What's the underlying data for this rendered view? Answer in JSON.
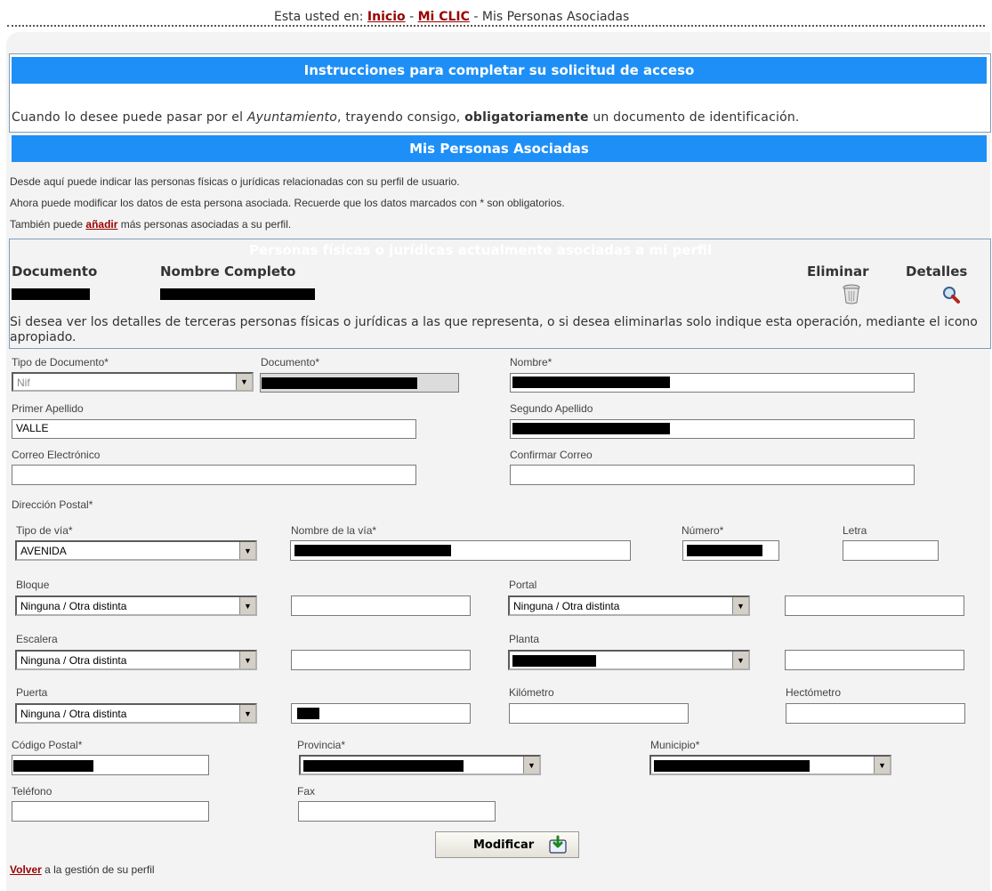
{
  "breadcrumb": {
    "prefix": "Esta usted en:",
    "items": [
      "Inicio",
      "Mi CLIC"
    ],
    "current": "Mis Personas Asociadas"
  },
  "instructions": {
    "title": "Instrucciones para completar su solicitud de acceso",
    "text_1": "Cuando lo desee puede pasar por el ",
    "text_em": "Ayuntamiento",
    "text_2": ", trayendo consigo, ",
    "text_strong": "obligatoriamente",
    "text_3": " un documento de identificación."
  },
  "section": {
    "title": "Mis Personas Asociadas",
    "line_1": "Desde aquí puede indicar las personas físicas o jurídicas relacionadas con su perfil de usuario.",
    "line_2": "Ahora puede modificar los datos de esta persona asociada. Recuerde que los datos marcados con * son obligatorios.",
    "line_3_prefix": "También puede ",
    "line_3_link": "añadir",
    "line_3_suffix": " más personas asociadas a su perfil."
  },
  "associated_table": {
    "title": "Personas físicas o jurídicas actualmente asociadas a mi perfil",
    "columns": [
      "Documento",
      "Nombre Completo",
      "Eliminar",
      "Detalles"
    ],
    "note": "Si desea ver los detalles de terceras personas físicas o jurídicas a las que representa, o si desea eliminarlas solo indique esta operación, mediante el icono apropiado."
  },
  "form": {
    "tipo_documento": {
      "label": "Tipo de Documento*",
      "value": "Nif"
    },
    "documento": {
      "label": "Documento*"
    },
    "nombre": {
      "label": "Nombre*"
    },
    "primer_apellido": {
      "label": "Primer Apellido",
      "value": "VALLE"
    },
    "segundo_apellido": {
      "label": "Segundo Apellido"
    },
    "correo": {
      "label": "Correo Electrónico",
      "value": ""
    },
    "confirmar_correo": {
      "label": "Confirmar Correo",
      "value": ""
    },
    "direccion_label": "Dirección Postal*",
    "tipo_via": {
      "label": "Tipo de vía*",
      "value": "AVENIDA"
    },
    "nombre_via": {
      "label": "Nombre de la vía*"
    },
    "numero": {
      "label": "Número*"
    },
    "letra": {
      "label": "Letra",
      "value": ""
    },
    "bloque": {
      "label": "Bloque",
      "value": "Ninguna / Otra distinta"
    },
    "portal": {
      "label": "Portal",
      "value": "Ninguna / Otra distinta"
    },
    "escalera": {
      "label": "Escalera",
      "value": "Ninguna / Otra distinta"
    },
    "planta": {
      "label": "Planta"
    },
    "puerta": {
      "label": "Puerta",
      "value": "Ninguna / Otra distinta"
    },
    "kilometro": {
      "label": "Kilómetro",
      "value": ""
    },
    "hectometro": {
      "label": "Hectómetro",
      "value": ""
    },
    "codigo_postal": {
      "label": "Código Postal*"
    },
    "provincia": {
      "label": "Provincia*"
    },
    "municipio": {
      "label": "Municipio*"
    },
    "telefono": {
      "label": "Teléfono",
      "value": ""
    },
    "fax": {
      "label": "Fax",
      "value": ""
    },
    "submit_label": "Modificar"
  },
  "footer": {
    "link": "Volver",
    "suffix": " a la gestión de su perfil"
  },
  "colors": {
    "header_blue": "#1e8ff7",
    "link_red": "#990000",
    "panel_bg": "#f3f3f3"
  }
}
